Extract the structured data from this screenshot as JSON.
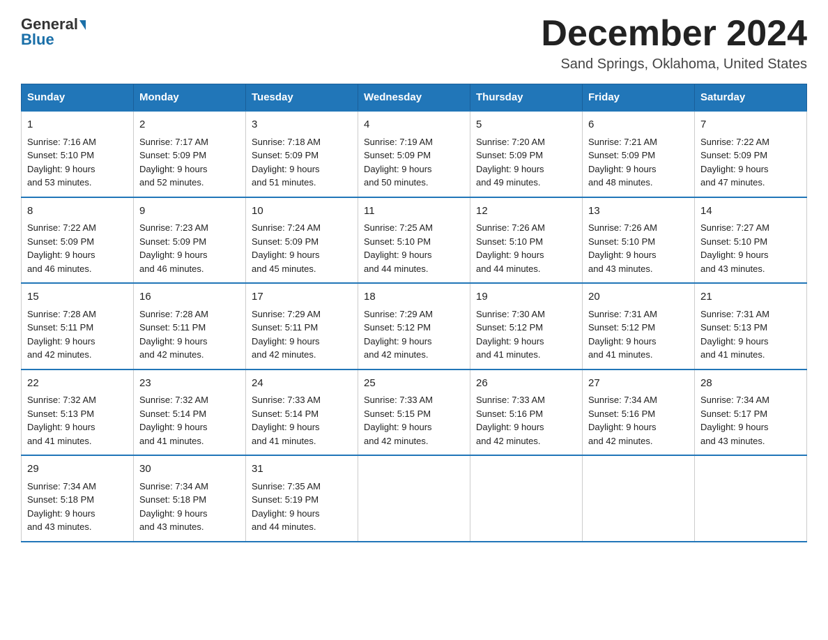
{
  "header": {
    "logo_general": "General",
    "logo_blue": "Blue",
    "month_title": "December 2024",
    "location": "Sand Springs, Oklahoma, United States"
  },
  "days_of_week": [
    "Sunday",
    "Monday",
    "Tuesday",
    "Wednesday",
    "Thursday",
    "Friday",
    "Saturday"
  ],
  "weeks": [
    [
      {
        "day": "1",
        "sunrise": "7:16 AM",
        "sunset": "5:10 PM",
        "daylight": "9 hours and 53 minutes."
      },
      {
        "day": "2",
        "sunrise": "7:17 AM",
        "sunset": "5:09 PM",
        "daylight": "9 hours and 52 minutes."
      },
      {
        "day": "3",
        "sunrise": "7:18 AM",
        "sunset": "5:09 PM",
        "daylight": "9 hours and 51 minutes."
      },
      {
        "day": "4",
        "sunrise": "7:19 AM",
        "sunset": "5:09 PM",
        "daylight": "9 hours and 50 minutes."
      },
      {
        "day": "5",
        "sunrise": "7:20 AM",
        "sunset": "5:09 PM",
        "daylight": "9 hours and 49 minutes."
      },
      {
        "day": "6",
        "sunrise": "7:21 AM",
        "sunset": "5:09 PM",
        "daylight": "9 hours and 48 minutes."
      },
      {
        "day": "7",
        "sunrise": "7:22 AM",
        "sunset": "5:09 PM",
        "daylight": "9 hours and 47 minutes."
      }
    ],
    [
      {
        "day": "8",
        "sunrise": "7:22 AM",
        "sunset": "5:09 PM",
        "daylight": "9 hours and 46 minutes."
      },
      {
        "day": "9",
        "sunrise": "7:23 AM",
        "sunset": "5:09 PM",
        "daylight": "9 hours and 46 minutes."
      },
      {
        "day": "10",
        "sunrise": "7:24 AM",
        "sunset": "5:09 PM",
        "daylight": "9 hours and 45 minutes."
      },
      {
        "day": "11",
        "sunrise": "7:25 AM",
        "sunset": "5:10 PM",
        "daylight": "9 hours and 44 minutes."
      },
      {
        "day": "12",
        "sunrise": "7:26 AM",
        "sunset": "5:10 PM",
        "daylight": "9 hours and 44 minutes."
      },
      {
        "day": "13",
        "sunrise": "7:26 AM",
        "sunset": "5:10 PM",
        "daylight": "9 hours and 43 minutes."
      },
      {
        "day": "14",
        "sunrise": "7:27 AM",
        "sunset": "5:10 PM",
        "daylight": "9 hours and 43 minutes."
      }
    ],
    [
      {
        "day": "15",
        "sunrise": "7:28 AM",
        "sunset": "5:11 PM",
        "daylight": "9 hours and 42 minutes."
      },
      {
        "day": "16",
        "sunrise": "7:28 AM",
        "sunset": "5:11 PM",
        "daylight": "9 hours and 42 minutes."
      },
      {
        "day": "17",
        "sunrise": "7:29 AM",
        "sunset": "5:11 PM",
        "daylight": "9 hours and 42 minutes."
      },
      {
        "day": "18",
        "sunrise": "7:29 AM",
        "sunset": "5:12 PM",
        "daylight": "9 hours and 42 minutes."
      },
      {
        "day": "19",
        "sunrise": "7:30 AM",
        "sunset": "5:12 PM",
        "daylight": "9 hours and 41 minutes."
      },
      {
        "day": "20",
        "sunrise": "7:31 AM",
        "sunset": "5:12 PM",
        "daylight": "9 hours and 41 minutes."
      },
      {
        "day": "21",
        "sunrise": "7:31 AM",
        "sunset": "5:13 PM",
        "daylight": "9 hours and 41 minutes."
      }
    ],
    [
      {
        "day": "22",
        "sunrise": "7:32 AM",
        "sunset": "5:13 PM",
        "daylight": "9 hours and 41 minutes."
      },
      {
        "day": "23",
        "sunrise": "7:32 AM",
        "sunset": "5:14 PM",
        "daylight": "9 hours and 41 minutes."
      },
      {
        "day": "24",
        "sunrise": "7:33 AM",
        "sunset": "5:14 PM",
        "daylight": "9 hours and 41 minutes."
      },
      {
        "day": "25",
        "sunrise": "7:33 AM",
        "sunset": "5:15 PM",
        "daylight": "9 hours and 42 minutes."
      },
      {
        "day": "26",
        "sunrise": "7:33 AM",
        "sunset": "5:16 PM",
        "daylight": "9 hours and 42 minutes."
      },
      {
        "day": "27",
        "sunrise": "7:34 AM",
        "sunset": "5:16 PM",
        "daylight": "9 hours and 42 minutes."
      },
      {
        "day": "28",
        "sunrise": "7:34 AM",
        "sunset": "5:17 PM",
        "daylight": "9 hours and 43 minutes."
      }
    ],
    [
      {
        "day": "29",
        "sunrise": "7:34 AM",
        "sunset": "5:18 PM",
        "daylight": "9 hours and 43 minutes."
      },
      {
        "day": "30",
        "sunrise": "7:34 AM",
        "sunset": "5:18 PM",
        "daylight": "9 hours and 43 minutes."
      },
      {
        "day": "31",
        "sunrise": "7:35 AM",
        "sunset": "5:19 PM",
        "daylight": "9 hours and 44 minutes."
      },
      null,
      null,
      null,
      null
    ]
  ],
  "labels": {
    "sunrise": "Sunrise:",
    "sunset": "Sunset:",
    "daylight": "Daylight:"
  }
}
